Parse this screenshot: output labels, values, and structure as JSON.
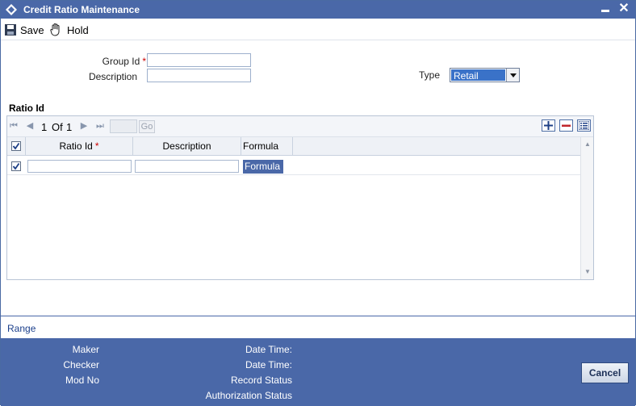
{
  "window": {
    "title": "Credit Ratio Maintenance"
  },
  "toolbar": {
    "save_label": "Save",
    "hold_label": "Hold"
  },
  "form": {
    "group_id_label": "Group Id",
    "group_id_value": "",
    "description_label": "Description",
    "description_value": "",
    "type_label": "Type",
    "type_value": "Retail",
    "required_marker": "*"
  },
  "ratio_section": {
    "title": "Ratio Id",
    "pager": {
      "current": "1",
      "of_label": "Of",
      "total": "1",
      "go_label": "Go"
    },
    "columns": [
      "Ratio Id",
      "Description",
      "Formula"
    ],
    "rows": [
      {
        "checked": true,
        "ratio_id": "",
        "description": "",
        "formula_label": "Formula"
      }
    ]
  },
  "range": {
    "label": "Range"
  },
  "footer": {
    "maker_label": "Maker",
    "checker_label": "Checker",
    "mod_no_label": "Mod No",
    "date_time_label_1": "Date Time:",
    "date_time_label_2": "Date Time:",
    "record_status_label": "Record Status",
    "authorization_status_label": "Authorization Status",
    "cancel_label": "Cancel"
  },
  "colors": {
    "brand": "#4a68a8",
    "required": "#cc0000",
    "selected": "#3a72c8"
  }
}
